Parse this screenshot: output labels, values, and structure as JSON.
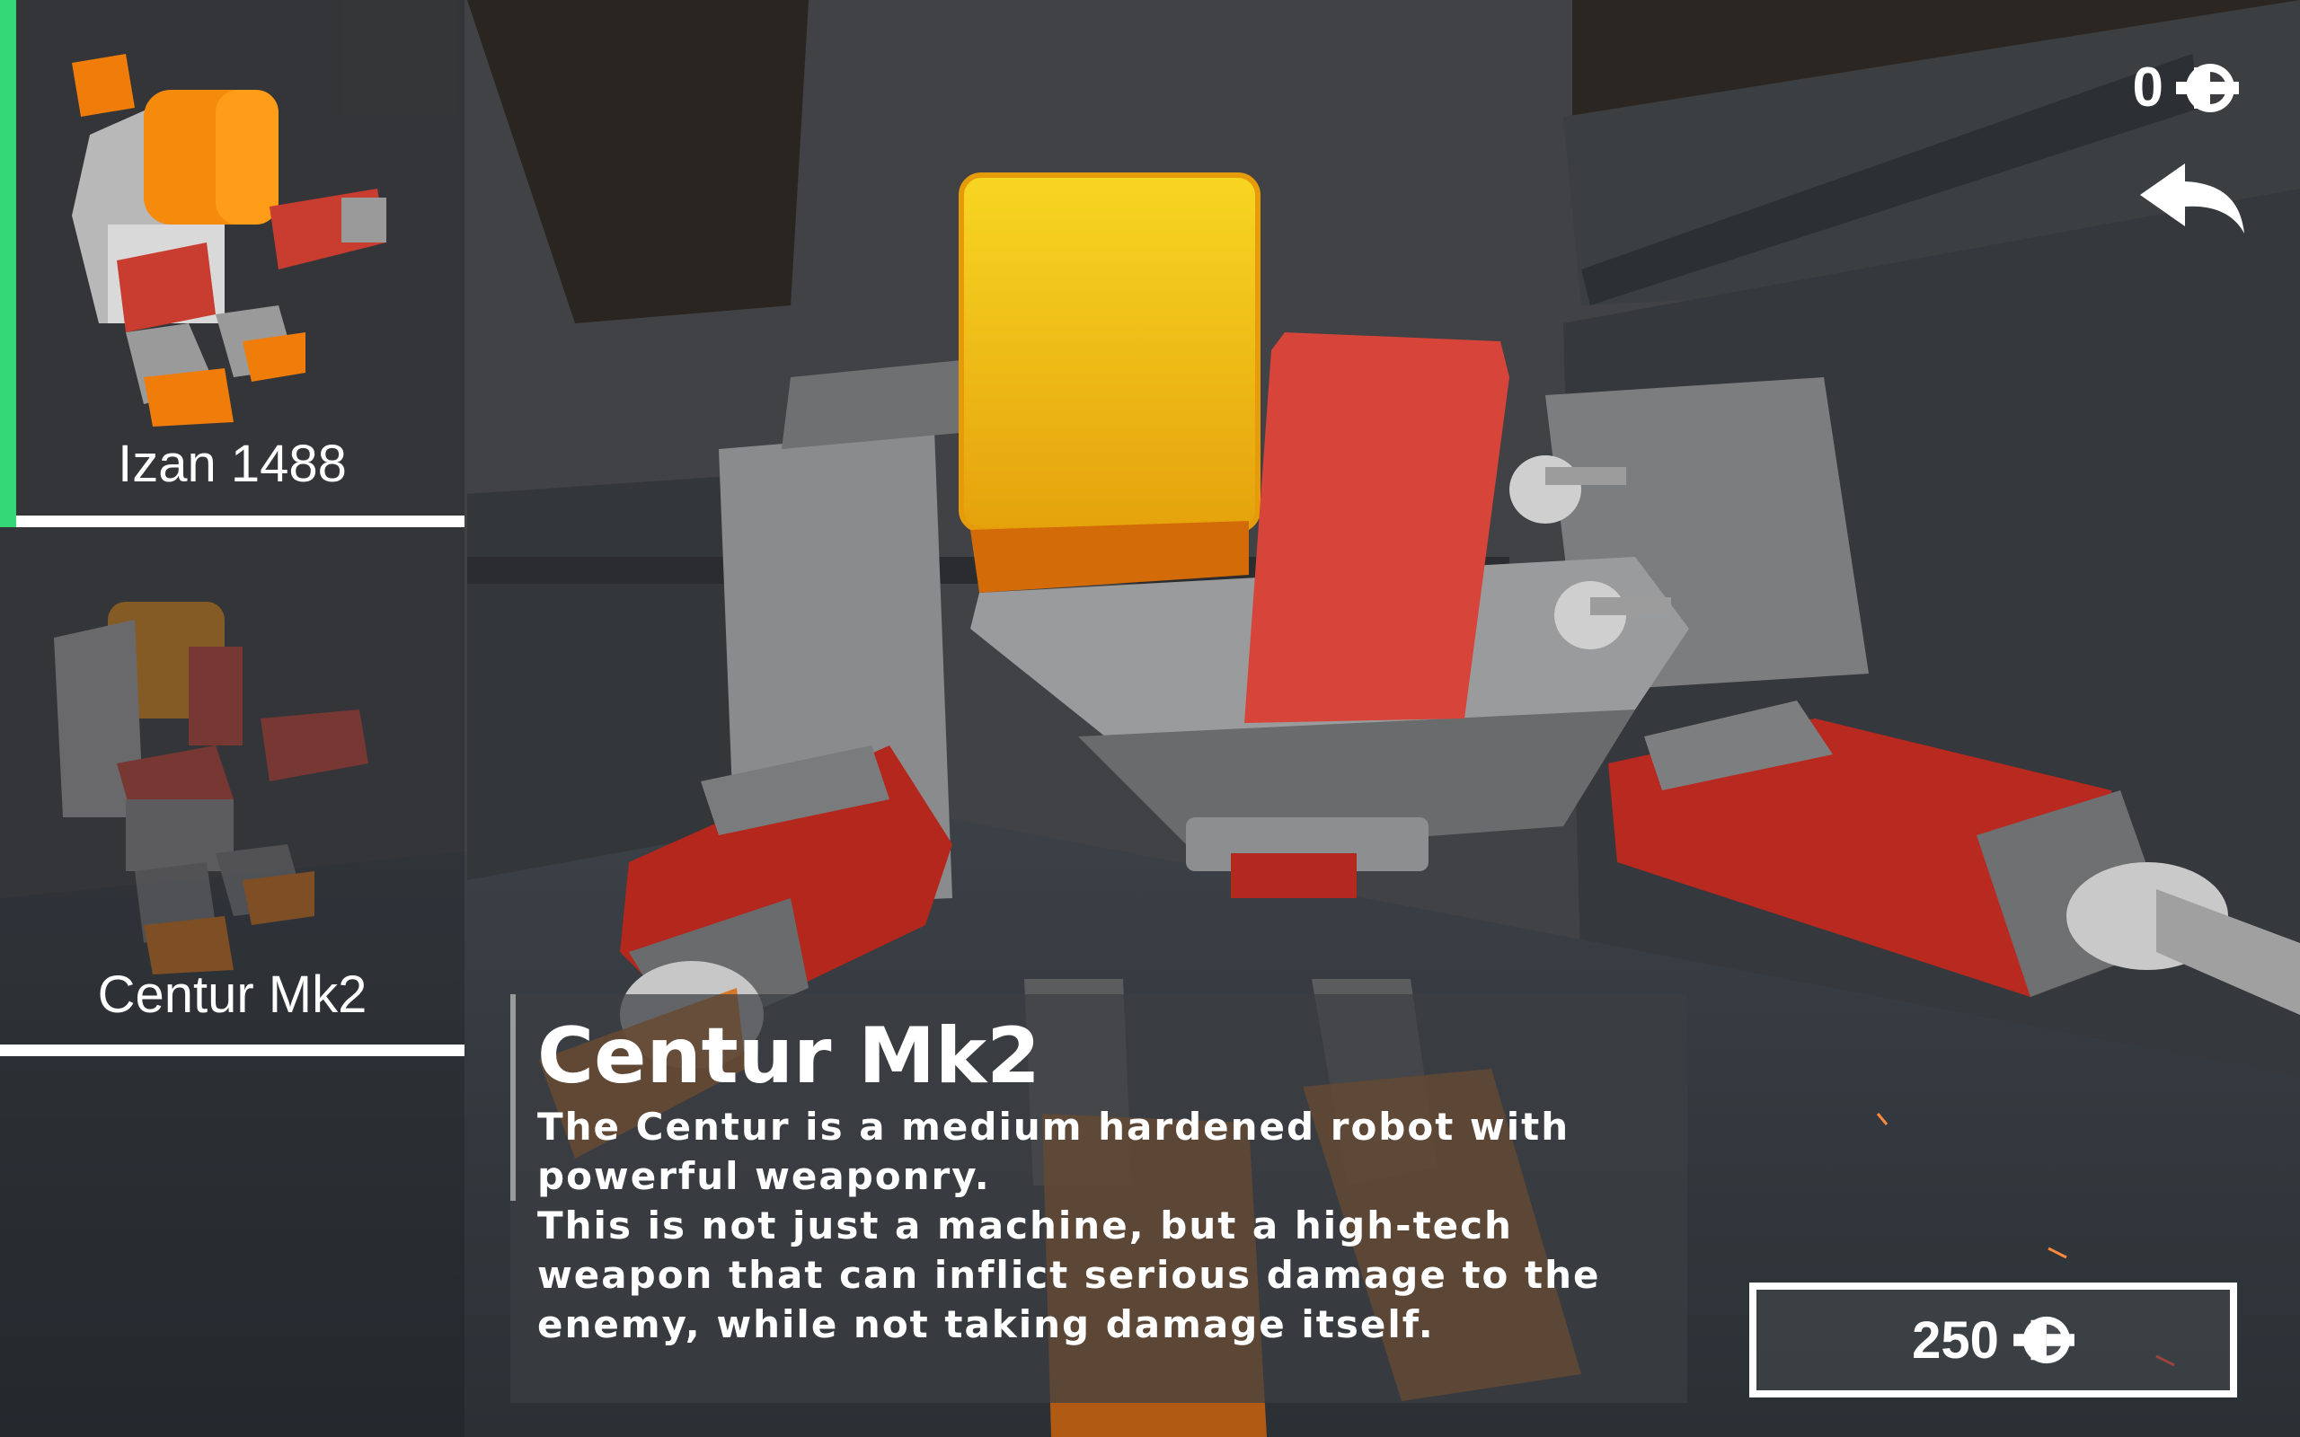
{
  "hud": {
    "currency_value": "0",
    "currency_icon": "coin-icon",
    "back_icon": "back-arrow-icon"
  },
  "robots": [
    {
      "name": "Izan 1488",
      "selected": true
    },
    {
      "name": "Centur Mk2",
      "selected": false
    }
  ],
  "details": {
    "title": "Centur Mk2",
    "paragraphs": [
      "The Centur is a medium hardened robot with powerful weaponry.",
      "This is not just a machine, but a high-tech weapon that can inflict serious damage to the enemy, while not taking damage itself."
    ]
  },
  "purchase": {
    "price": "250",
    "currency_icon": "coin-icon"
  },
  "colors": {
    "selected_accent": "#35d877",
    "robot_red": "#c8342c",
    "robot_yellow": "#f2c20f",
    "robot_orange": "#e86a10",
    "robot_grey": "#8c8c8c"
  }
}
